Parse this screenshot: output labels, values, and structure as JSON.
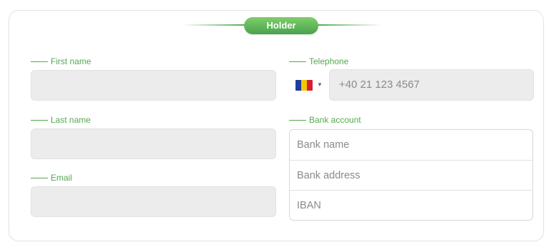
{
  "section": {
    "title": "Holder"
  },
  "fields": {
    "first_name_label": "First name",
    "last_name_label": "Last name",
    "email_label": "Email",
    "telephone_label": "Telephone",
    "telephone_placeholder": "+40 21 123 4567",
    "bank_account_label": "Bank account",
    "bank_name_placeholder": "Bank name",
    "bank_address_placeholder": "Bank address",
    "iban_placeholder": "IBAN"
  },
  "icons": {
    "flag": "romania-flag-icon",
    "caret": "chevron-down-icon"
  },
  "colors": {
    "accent": "#55a84f",
    "field_background": "#ececec"
  }
}
